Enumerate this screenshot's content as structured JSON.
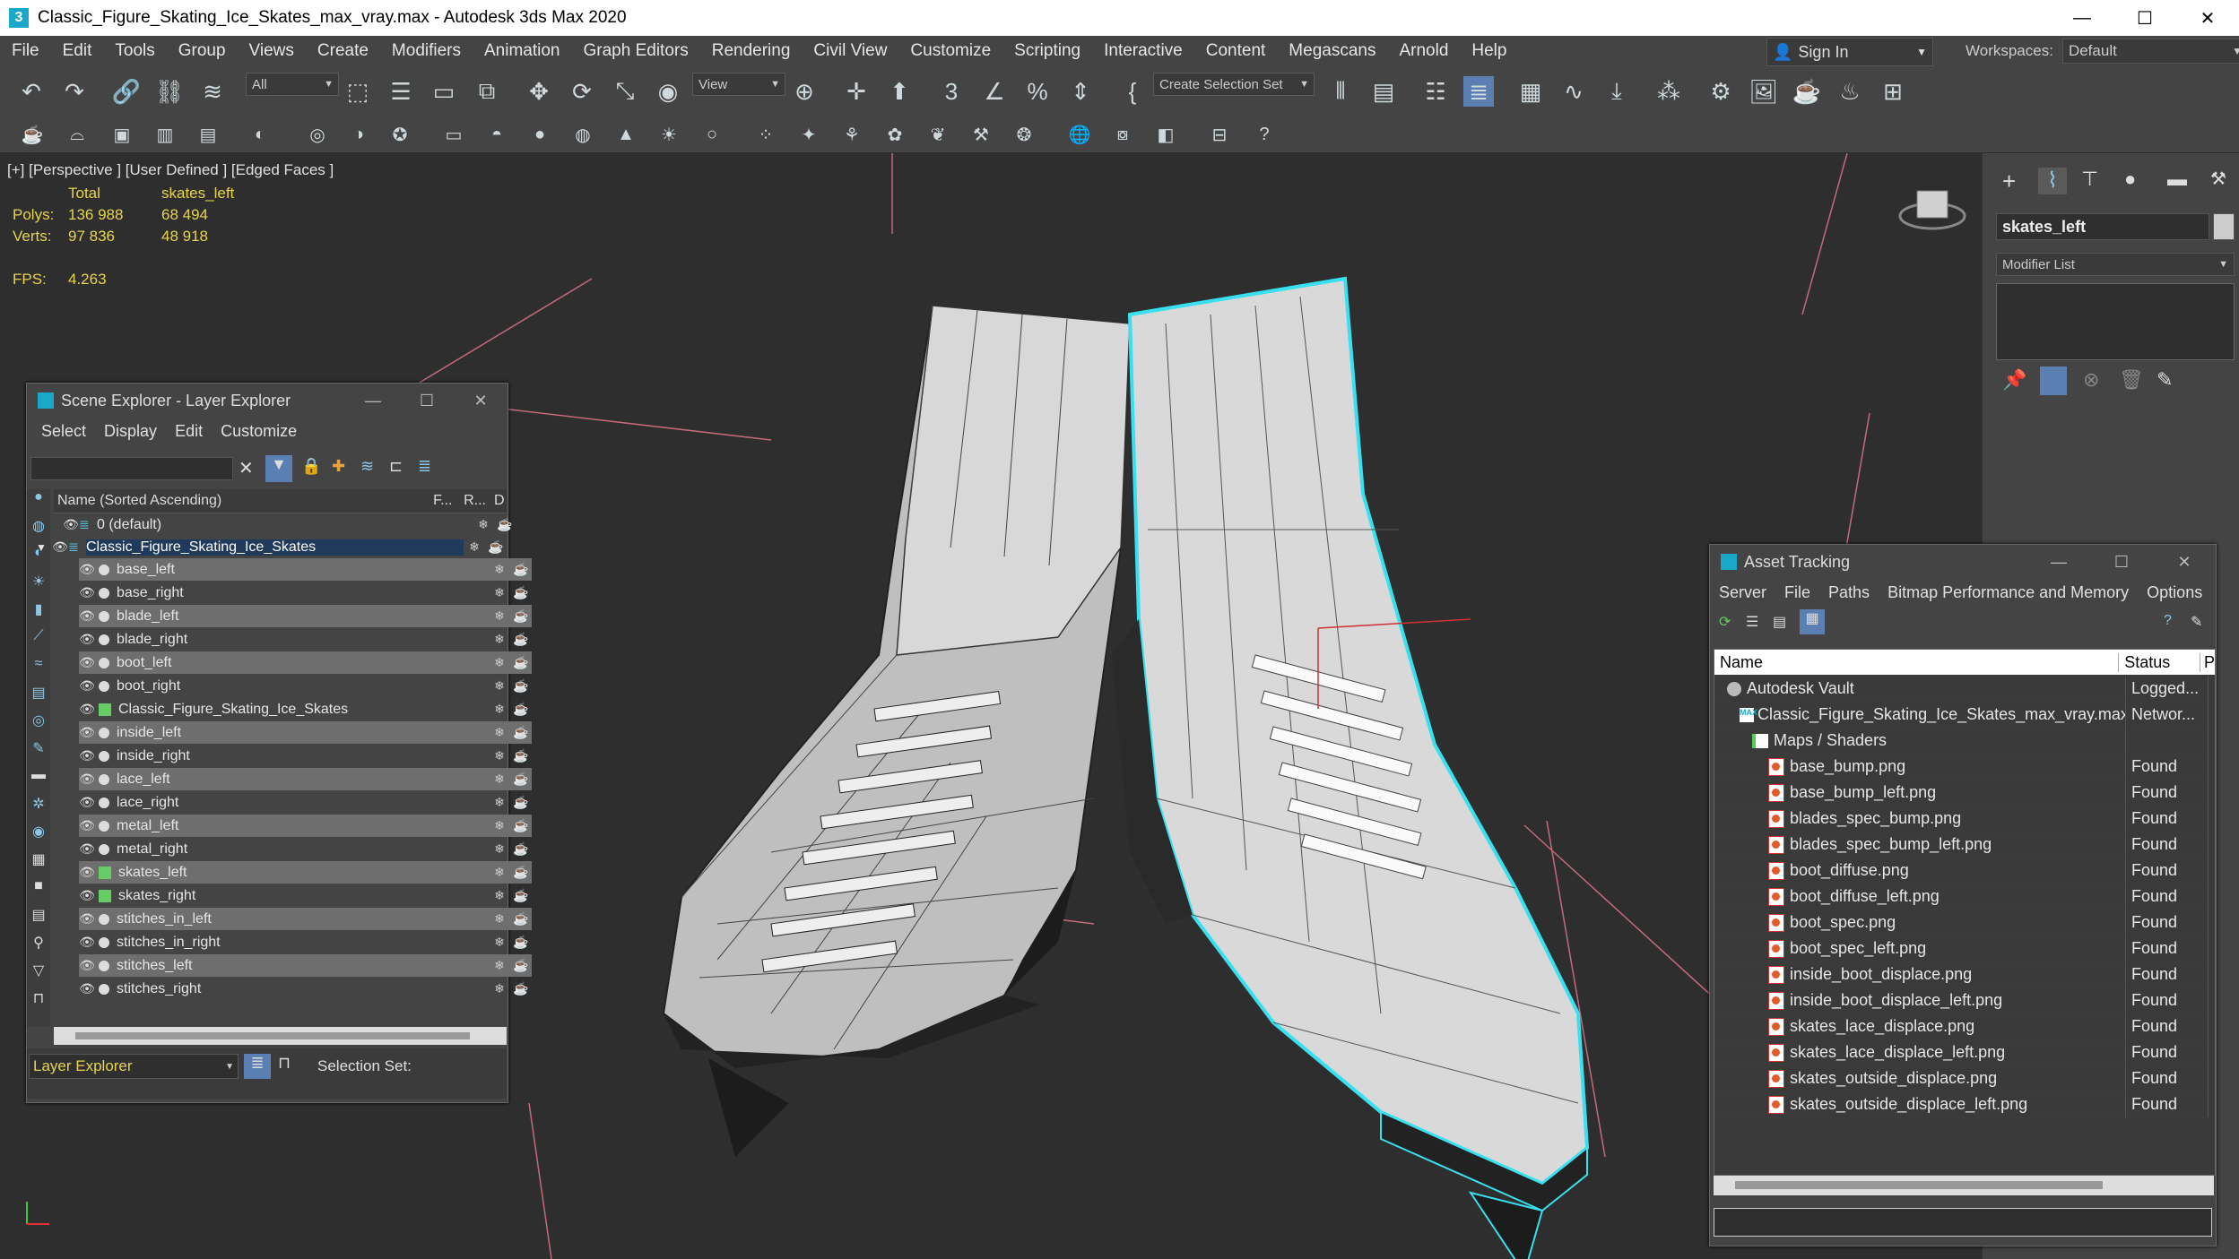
{
  "window": {
    "title": "Classic_Figure_Skating_Ice_Skates_max_vray.max - Autodesk 3ds Max 2020",
    "app_icon": "3"
  },
  "menu": [
    "File",
    "Edit",
    "Tools",
    "Group",
    "Views",
    "Create",
    "Modifiers",
    "Animation",
    "Graph Editors",
    "Rendering",
    "Civil View",
    "Customize",
    "Scripting",
    "Interactive",
    "Content",
    "Megascans",
    "Arnold",
    "Help"
  ],
  "signin": {
    "label": "Sign In"
  },
  "workspaces": {
    "label": "Workspaces:",
    "value": "Default"
  },
  "toolbar": {
    "filter_value": "All",
    "ref_coord": "View",
    "selection_set": "Create Selection Set"
  },
  "viewport": {
    "label": "[+] [Perspective ] [User Defined ] [Edged Faces ]",
    "stats": {
      "col_total": "Total",
      "col_obj": "skates_left",
      "polys_label": "Polys:",
      "polys_total": "136 988",
      "polys_obj": "68 494",
      "verts_label": "Verts:",
      "verts_total": "97 836",
      "verts_obj": "48 918",
      "fps_label": "FPS:",
      "fps_value": "4.263"
    }
  },
  "command_panel": {
    "object_name": "skates_left",
    "modifier_list": "Modifier List"
  },
  "scene_explorer": {
    "title": "Scene Explorer - Layer Explorer",
    "menu": [
      "Select",
      "Display",
      "Edit",
      "Customize"
    ],
    "col_name": "Name (Sorted Ascending)",
    "col_f": "F...",
    "col_r": "R...",
    "col_d": "D",
    "layer_default": "0 (default)",
    "layer_main": "Classic_Figure_Skating_Ice_Skates",
    "items": [
      "base_left",
      "base_right",
      "blade_left",
      "blade_right",
      "boot_left",
      "boot_right",
      "Classic_Figure_Skating_Ice_Skates",
      "inside_left",
      "inside_right",
      "lace_left",
      "lace_right",
      "metal_left",
      "metal_right",
      "skates_left",
      "skates_right",
      "stitches_in_left",
      "stitches_in_right",
      "stitches_left",
      "stitches_right"
    ],
    "bottom_label": "Layer Explorer",
    "selection_set_label": "Selection Set:"
  },
  "asset_tracking": {
    "title": "Asset Tracking",
    "menu": [
      "Server",
      "File",
      "Paths",
      "Bitmap Performance and Memory",
      "Options"
    ],
    "col_name": "Name",
    "col_status": "Status",
    "col_p": "P",
    "rows": [
      {
        "name": "Autodesk Vault",
        "status": "Logged..."
      },
      {
        "name": "Classic_Figure_Skating_Ice_Skates_max_vray.max",
        "status": "Networ..."
      },
      {
        "name": "Maps / Shaders",
        "status": ""
      },
      {
        "name": "base_bump.png",
        "status": "Found"
      },
      {
        "name": "base_bump_left.png",
        "status": "Found"
      },
      {
        "name": "blades_spec_bump.png",
        "status": "Found"
      },
      {
        "name": "blades_spec_bump_left.png",
        "status": "Found"
      },
      {
        "name": "boot_diffuse.png",
        "status": "Found"
      },
      {
        "name": "boot_diffuse_left.png",
        "status": "Found"
      },
      {
        "name": "boot_spec.png",
        "status": "Found"
      },
      {
        "name": "boot_spec_left.png",
        "status": "Found"
      },
      {
        "name": "inside_boot_displace.png",
        "status": "Found"
      },
      {
        "name": "inside_boot_displace_left.png",
        "status": "Found"
      },
      {
        "name": "skates_lace_displace.png",
        "status": "Found"
      },
      {
        "name": "skates_lace_displace_left.png",
        "status": "Found"
      },
      {
        "name": "skates_outside_displace.png",
        "status": "Found"
      },
      {
        "name": "skates_outside_displace_left.png",
        "status": "Found"
      }
    ]
  },
  "colors": {
    "accent": "#1aa8c9",
    "stats_yellow": "#e8d44d",
    "selection_cyan": "#39e0f0"
  }
}
